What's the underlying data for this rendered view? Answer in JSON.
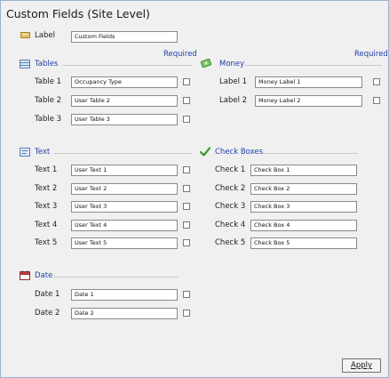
{
  "window": {
    "title": "Custom Fields (Site Level)"
  },
  "label_field": {
    "label": "Label",
    "value": "Custom Fields"
  },
  "required_text": "Required",
  "tables": {
    "title": "Tables",
    "rows": [
      {
        "label": "Table 1",
        "value": "Occupancy Type"
      },
      {
        "label": "Table 2",
        "value": "User Table 2"
      },
      {
        "label": "Table 3",
        "value": "User Table 3"
      }
    ]
  },
  "money": {
    "title": "Money",
    "rows": [
      {
        "label": "Label 1",
        "value": "Money Label 1"
      },
      {
        "label": "Label 2",
        "value": "Money Label 2"
      }
    ]
  },
  "text": {
    "title": "Text",
    "rows": [
      {
        "label": "Text 1",
        "value": "User Text 1"
      },
      {
        "label": "Text 2",
        "value": "User Text 2"
      },
      {
        "label": "Text 3",
        "value": "User Text 3"
      },
      {
        "label": "Text 4",
        "value": "User Text 4"
      },
      {
        "label": "Text 5",
        "value": "User Text 5"
      }
    ]
  },
  "checkboxes": {
    "title": "Check Boxes",
    "rows": [
      {
        "label": "Check 1",
        "value": "Check Box 1"
      },
      {
        "label": "Check 2",
        "value": "Check Box 2"
      },
      {
        "label": "Check 3",
        "value": "Check Box 3"
      },
      {
        "label": "Check 4",
        "value": "Check Box 4"
      },
      {
        "label": "Check 5",
        "value": "Check Box 5"
      }
    ]
  },
  "date": {
    "title": "Date",
    "rows": [
      {
        "label": "Date 1",
        "value": "Date 1"
      },
      {
        "label": "Date 2",
        "value": "Date 2"
      }
    ]
  },
  "buttons": {
    "apply": "Apply"
  },
  "icons": {
    "label": "label-tag-icon",
    "tables": "table-grid-icon",
    "money": "money-bill-icon",
    "text": "text-box-icon",
    "checkboxes": "checkmark-icon",
    "date": "calendar-icon"
  }
}
